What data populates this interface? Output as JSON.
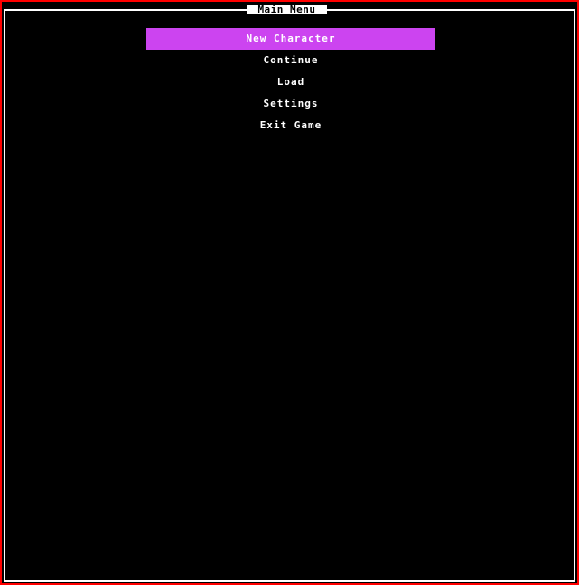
{
  "window": {
    "title": "Main Menu"
  },
  "colors": {
    "outer_border": "#ff0000",
    "inner_border": "#ffffff",
    "background": "#000000",
    "selected_item_bg": "#cc44f0",
    "text": "#ffffff"
  },
  "menu": {
    "selected_index": 0,
    "items": [
      {
        "label": "New Character"
      },
      {
        "label": "Continue"
      },
      {
        "label": "Load"
      },
      {
        "label": "Settings"
      },
      {
        "label": "Exit Game"
      }
    ]
  }
}
